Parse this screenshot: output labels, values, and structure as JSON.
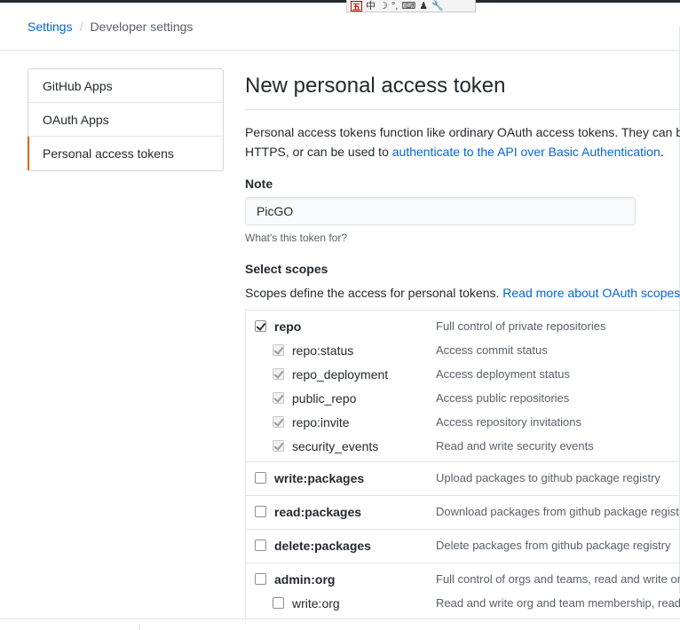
{
  "ime_toolbar": {
    "box_label": "五",
    "mode_label": "中"
  },
  "breadcrumb": {
    "link": "Settings",
    "separator": "/",
    "current": "Developer settings"
  },
  "menu": {
    "items": [
      {
        "label": "GitHub Apps"
      },
      {
        "label": "OAuth Apps"
      },
      {
        "label": "Personal access tokens"
      }
    ]
  },
  "page": {
    "title": "New personal access token",
    "intro_line1": "Personal access tokens function like ordinary OAuth access tokens. They can be",
    "intro_line2_prefix": "HTTPS, or can be used to ",
    "intro_link": "authenticate to the API over Basic Authentication",
    "intro_line2_suffix": "."
  },
  "note": {
    "label": "Note",
    "value": "PicGO",
    "hint": "What's this token for?"
  },
  "scopes": {
    "label": "Select scopes",
    "description": "Scopes define the access for personal tokens. ",
    "description_link": "Read more about OAuth scopes.",
    "groups": [
      {
        "name": "repo",
        "description": "Full control of private repositories",
        "checked": true,
        "children": [
          {
            "name": "repo:status",
            "description": "Access commit status",
            "checked": true
          },
          {
            "name": "repo_deployment",
            "description": "Access deployment status",
            "checked": true
          },
          {
            "name": "public_repo",
            "description": "Access public repositories",
            "checked": true
          },
          {
            "name": "repo:invite",
            "description": "Access repository invitations",
            "checked": true
          },
          {
            "name": "security_events",
            "description": "Read and write security events",
            "checked": true
          }
        ]
      },
      {
        "name": "write:packages",
        "description": "Upload packages to github package registry",
        "checked": false,
        "children": []
      },
      {
        "name": "read:packages",
        "description": "Download packages from github package regist",
        "checked": false,
        "children": []
      },
      {
        "name": "delete:packages",
        "description": "Delete packages from github package registry",
        "checked": false,
        "children": []
      },
      {
        "name": "admin:org",
        "description": "Full control of orgs and teams, read and write or",
        "checked": false,
        "children": [
          {
            "name": "write:org",
            "description": "Read and write org and team membership, read",
            "checked": false
          }
        ]
      }
    ]
  },
  "colors": {
    "link": "#0366d6",
    "selected_accent": "#e36209",
    "text": "#24292e",
    "muted": "#586069"
  }
}
